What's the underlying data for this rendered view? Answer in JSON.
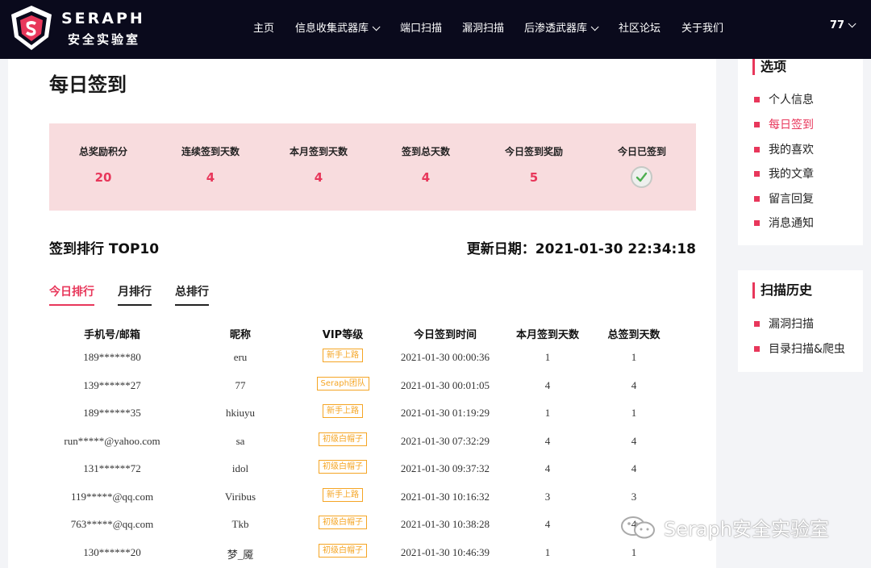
{
  "brand": {
    "title": "SERAPH",
    "subtitle": "安全实验室"
  },
  "nav": {
    "items": [
      {
        "label": "主页",
        "dropdown": false
      },
      {
        "label": "信息收集武器库",
        "dropdown": true
      },
      {
        "label": "端口扫描",
        "dropdown": false
      },
      {
        "label": "漏洞扫描",
        "dropdown": false
      },
      {
        "label": "后渗透武器库",
        "dropdown": true
      },
      {
        "label": "社区论坛",
        "dropdown": false
      },
      {
        "label": "关于我们",
        "dropdown": false
      }
    ],
    "user": "77"
  },
  "page": {
    "title": "每日签到"
  },
  "stats": [
    {
      "label": "总奖励积分",
      "value": "20"
    },
    {
      "label": "连续签到天数",
      "value": "4"
    },
    {
      "label": "本月签到天数",
      "value": "4"
    },
    {
      "label": "签到总天数",
      "value": "4"
    },
    {
      "label": "今日签到奖励",
      "value": "5"
    },
    {
      "label": "今日已签到",
      "icon": "check-icon"
    }
  ],
  "ranking": {
    "title": "签到排行 TOP10",
    "update_label": "更新日期：2021-01-30 22:34:18",
    "tabs": [
      "今日排行",
      "月排行",
      "总排行"
    ],
    "active_tab": 0,
    "columns": [
      "手机号/邮箱",
      "昵称",
      "VIP等级",
      "今日签到时间",
      "本月签到天数",
      "总签到天数"
    ],
    "rows": [
      {
        "account": "189******80",
        "nick": "eru",
        "vip": "新手上路",
        "time": "2021-01-30 00:00:36",
        "month": "1",
        "total": "1"
      },
      {
        "account": "139******27",
        "nick": "77",
        "vip": "Seraph团队",
        "time": "2021-01-30 00:01:05",
        "month": "4",
        "total": "4"
      },
      {
        "account": "189******35",
        "nick": "hkiuyu",
        "vip": "新手上路",
        "time": "2021-01-30 01:19:29",
        "month": "1",
        "total": "1"
      },
      {
        "account": "run*****@yahoo.com",
        "nick": "sa",
        "vip": "初级白帽子",
        "time": "2021-01-30 07:32:29",
        "month": "4",
        "total": "4"
      },
      {
        "account": "131******72",
        "nick": "idol",
        "vip": "初级白帽子",
        "time": "2021-01-30 09:37:32",
        "month": "4",
        "total": "4"
      },
      {
        "account": "119*****@qq.com",
        "nick": "Viribus",
        "vip": "新手上路",
        "time": "2021-01-30 10:16:32",
        "month": "3",
        "total": "3"
      },
      {
        "account": "763*****@qq.com",
        "nick": "Tkb",
        "vip": "初级白帽子",
        "time": "2021-01-30 10:38:28",
        "month": "4",
        "total": "4"
      },
      {
        "account": "130******20",
        "nick": "梦_魇",
        "vip": "初级白帽子",
        "time": "2021-01-30 10:46:39",
        "month": "1",
        "total": "1"
      }
    ]
  },
  "sidebar": {
    "options_title": "选项",
    "options": [
      "个人信息",
      "每日签到",
      "我的喜欢",
      "我的文章",
      "留言回复",
      "消息通知"
    ],
    "active_option": 1,
    "history_title": "扫描历史",
    "history": [
      "漏洞扫描",
      "目录扫描&爬虫"
    ]
  },
  "watermark": {
    "text": "Seraph安全实验室"
  },
  "colors": {
    "accent": "#e8375b",
    "navbar": "#0a0a1c",
    "stats_bg": "#f8dcde",
    "badge": "#f5a524"
  }
}
